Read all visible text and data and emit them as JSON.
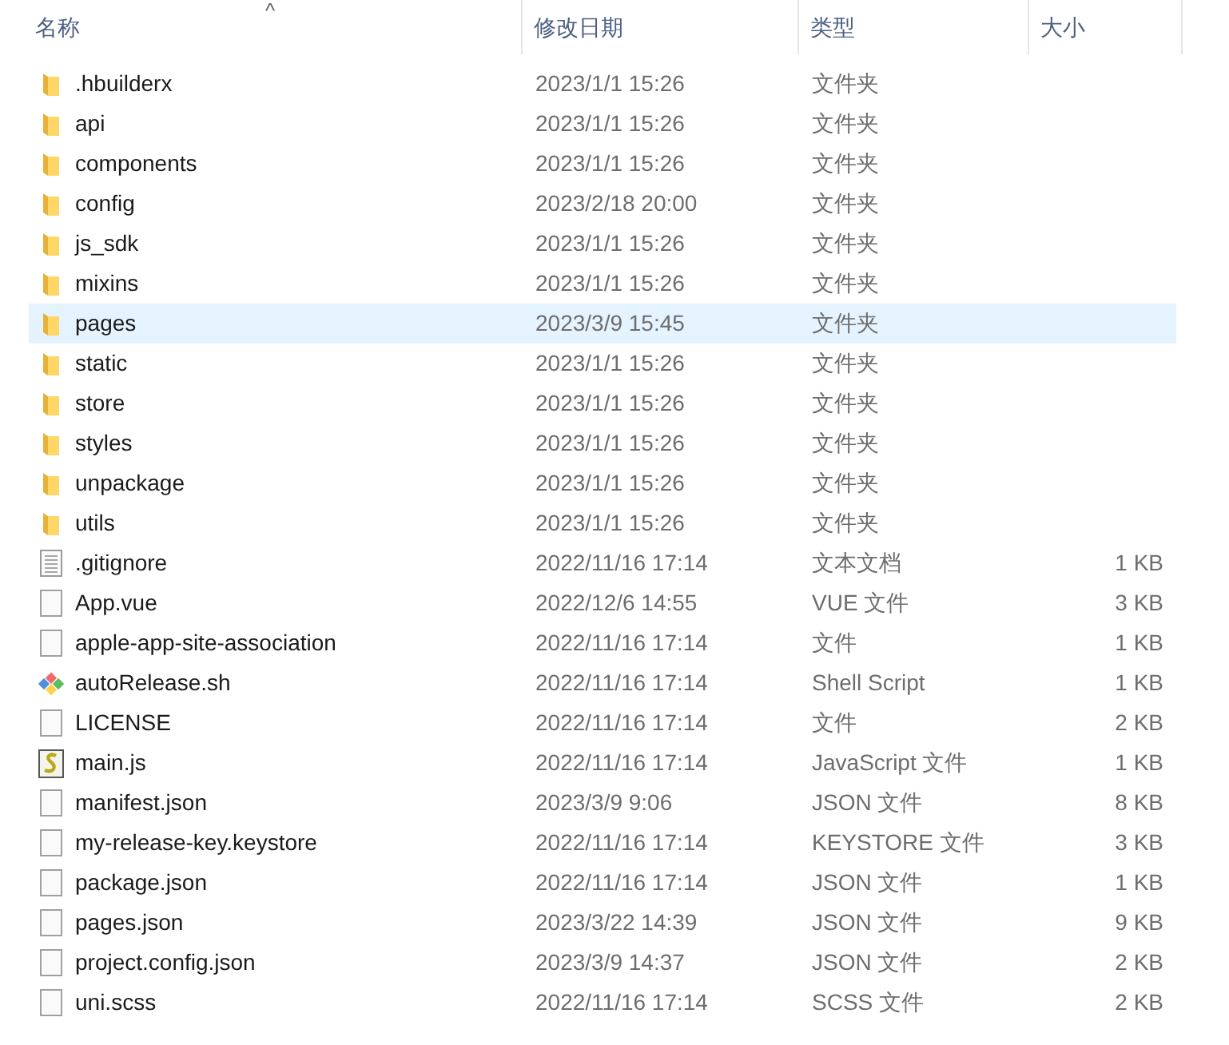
{
  "columns": [
    {
      "label": "名称",
      "sorted": true
    },
    {
      "label": "修改日期",
      "sorted": false
    },
    {
      "label": "类型",
      "sorted": false
    },
    {
      "label": "大小",
      "sorted": false
    }
  ],
  "sort_indicator": "^",
  "rows": [
    {
      "kind": "folder",
      "name": ".hbuilderx",
      "date": "2023/1/1 15:26",
      "type": "文件夹",
      "selected": false
    },
    {
      "kind": "folder",
      "name": "api",
      "date": "2023/1/1 15:26",
      "type": "文件夹",
      "selected": false
    },
    {
      "kind": "folder",
      "name": "components",
      "date": "2023/1/1 15:26",
      "type": "文件夹",
      "selected": false
    },
    {
      "kind": "folder",
      "name": "config",
      "date": "2023/2/18 20:00",
      "type": "文件夹",
      "selected": false
    },
    {
      "kind": "folder",
      "name": "js_sdk",
      "date": "2023/1/1 15:26",
      "type": "文件夹",
      "selected": false
    },
    {
      "kind": "folder",
      "name": "mixins",
      "date": "2023/1/1 15:26",
      "type": "文件夹",
      "selected": false
    },
    {
      "kind": "folder",
      "name": "pages",
      "date": "2023/3/9 15:45",
      "type": "文件夹",
      "selected": true
    },
    {
      "kind": "folder",
      "name": "static",
      "date": "2023/1/1 15:26",
      "type": "文件夹",
      "selected": false
    },
    {
      "kind": "folder",
      "name": "store",
      "date": "2023/1/1 15:26",
      "type": "文件夹",
      "selected": false
    },
    {
      "kind": "folder",
      "name": "styles",
      "date": "2023/1/1 15:26",
      "type": "文件夹",
      "selected": false
    },
    {
      "kind": "folder",
      "name": "unpackage",
      "date": "2023/1/1 15:26",
      "type": "文件夹",
      "selected": false
    },
    {
      "kind": "folder",
      "name": "utils",
      "date": "2023/1/1 15:26",
      "type": "文件夹",
      "selected": false
    },
    {
      "kind": "text",
      "name": ".gitignore",
      "date": "2022/11/16 17:14",
      "type": "文本文档",
      "size": "1 KB",
      "selected": false
    },
    {
      "kind": "file",
      "name": "App.vue",
      "date": "2022/12/6 14:55",
      "type": "VUE 文件",
      "size": "3 KB",
      "selected": false
    },
    {
      "kind": "file",
      "name": "apple-app-site-association",
      "date": "2022/11/16 17:14",
      "type": "文件",
      "size": "1 KB",
      "selected": false
    },
    {
      "kind": "shell",
      "name": "autoRelease.sh",
      "date": "2022/11/16 17:14",
      "type": "Shell Script",
      "size": "1 KB",
      "selected": false
    },
    {
      "kind": "file",
      "name": "LICENSE",
      "date": "2022/11/16 17:14",
      "type": "文件",
      "size": "2 KB",
      "selected": false
    },
    {
      "kind": "script",
      "name": "main.js",
      "date": "2022/11/16 17:14",
      "type": "JavaScript 文件",
      "size": "1 KB",
      "selected": false
    },
    {
      "kind": "file",
      "name": "manifest.json",
      "date": "2023/3/9 9:06",
      "type": "JSON 文件",
      "size": "8 KB",
      "selected": false
    },
    {
      "kind": "file",
      "name": "my-release-key.keystore",
      "date": "2022/11/16 17:14",
      "type": "KEYSTORE 文件",
      "size": "3 KB",
      "selected": false
    },
    {
      "kind": "file",
      "name": "package.json",
      "date": "2022/11/16 17:14",
      "type": "JSON 文件",
      "size": "1 KB",
      "selected": false
    },
    {
      "kind": "file",
      "name": "pages.json",
      "date": "2023/3/22 14:39",
      "type": "JSON 文件",
      "size": "9 KB",
      "selected": false
    },
    {
      "kind": "file",
      "name": "project.config.json",
      "date": "2023/3/9 14:37",
      "type": "JSON 文件",
      "size": "2 KB",
      "selected": false
    },
    {
      "kind": "file",
      "name": "uni.scss",
      "date": "2022/11/16 17:14",
      "type": "SCSS 文件",
      "size": "2 KB",
      "selected": false
    }
  ]
}
